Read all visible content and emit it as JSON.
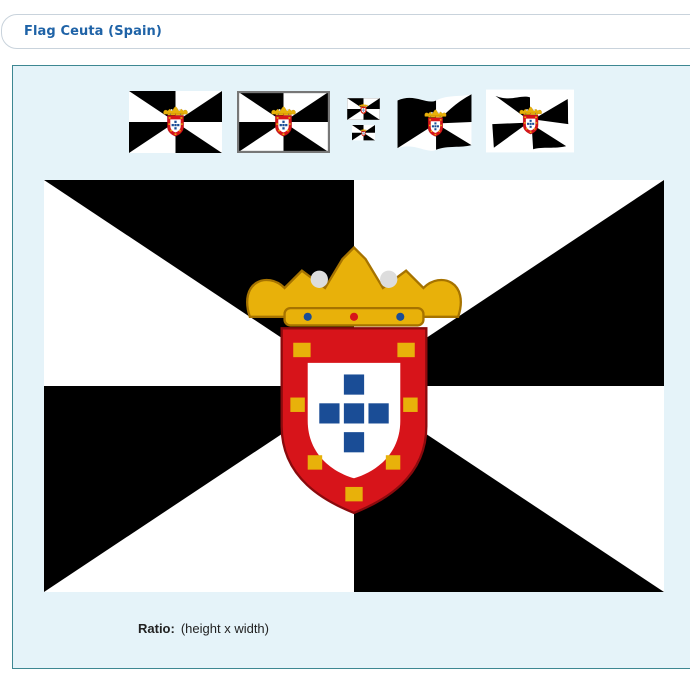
{
  "header": {
    "title": "Flag Ceuta (Spain)"
  },
  "thumbnails": [
    {
      "name": "flat"
    },
    {
      "name": "framed"
    },
    {
      "name": "small-icons"
    },
    {
      "name": "waving"
    },
    {
      "name": "waving-2"
    }
  ],
  "ratio": {
    "label": "Ratio:",
    "value": "(height x width)"
  },
  "colors": {
    "black": "#000000",
    "white": "#ffffff",
    "red": "#d7141a",
    "gold": "#e8b10a",
    "blue": "#1a4d96",
    "accent": "#1f63a7"
  }
}
